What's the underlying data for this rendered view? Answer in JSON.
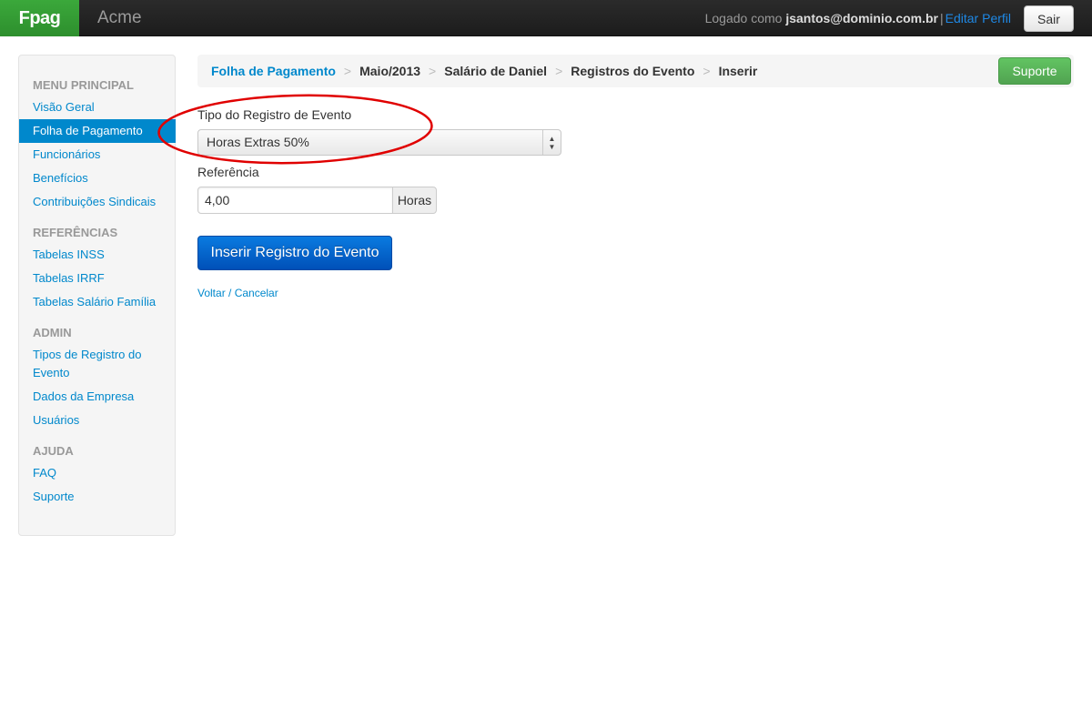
{
  "navbar": {
    "brand": "Fpag",
    "company": "Acme",
    "logged_as_prefix": "Logado como",
    "user_email": "jsantos@dominio.com.br",
    "separator": "|",
    "edit_profile": "Editar Perfil",
    "logout": "Sair"
  },
  "sidebar": {
    "sections": [
      {
        "header": "MENU PRINCIPAL",
        "items": [
          {
            "label": "Visão Geral"
          },
          {
            "label": "Folha de Pagamento",
            "active": true
          },
          {
            "label": "Funcionários"
          },
          {
            "label": "Benefícios"
          },
          {
            "label": "Contribuições Sindicais"
          }
        ]
      },
      {
        "header": "REFERÊNCIAS",
        "items": [
          {
            "label": "Tabelas INSS"
          },
          {
            "label": "Tabelas IRRF"
          },
          {
            "label": "Tabelas Salário Família"
          }
        ]
      },
      {
        "header": "ADMIN",
        "items": [
          {
            "label": "Tipos de Registro do Evento"
          },
          {
            "label": "Dados da Empresa"
          },
          {
            "label": "Usuários"
          }
        ]
      },
      {
        "header": "AJUDA",
        "items": [
          {
            "label": "FAQ"
          },
          {
            "label": "Suporte"
          }
        ]
      }
    ]
  },
  "breadcrumb": {
    "items": [
      "Folha de Pagamento",
      "Maio/2013",
      "Salário de Daniel",
      "Registros do Evento",
      "Inserir"
    ],
    "divider": ">",
    "support_button": "Suporte"
  },
  "form": {
    "event_type_label": "Tipo do Registro de Evento",
    "event_type_value": "Horas Extras 50%",
    "reference_label": "Referência",
    "reference_value": "4,00",
    "reference_unit": "Horas",
    "submit_label": "Inserir Registro do Evento",
    "cancel_link": "Voltar / Cancelar"
  },
  "colors": {
    "brand_green": "#34a034",
    "link_blue": "#0088cc",
    "primary_button": "#0a66d0",
    "success_button": "#5bb75b",
    "annotation_red": "#e00000"
  }
}
